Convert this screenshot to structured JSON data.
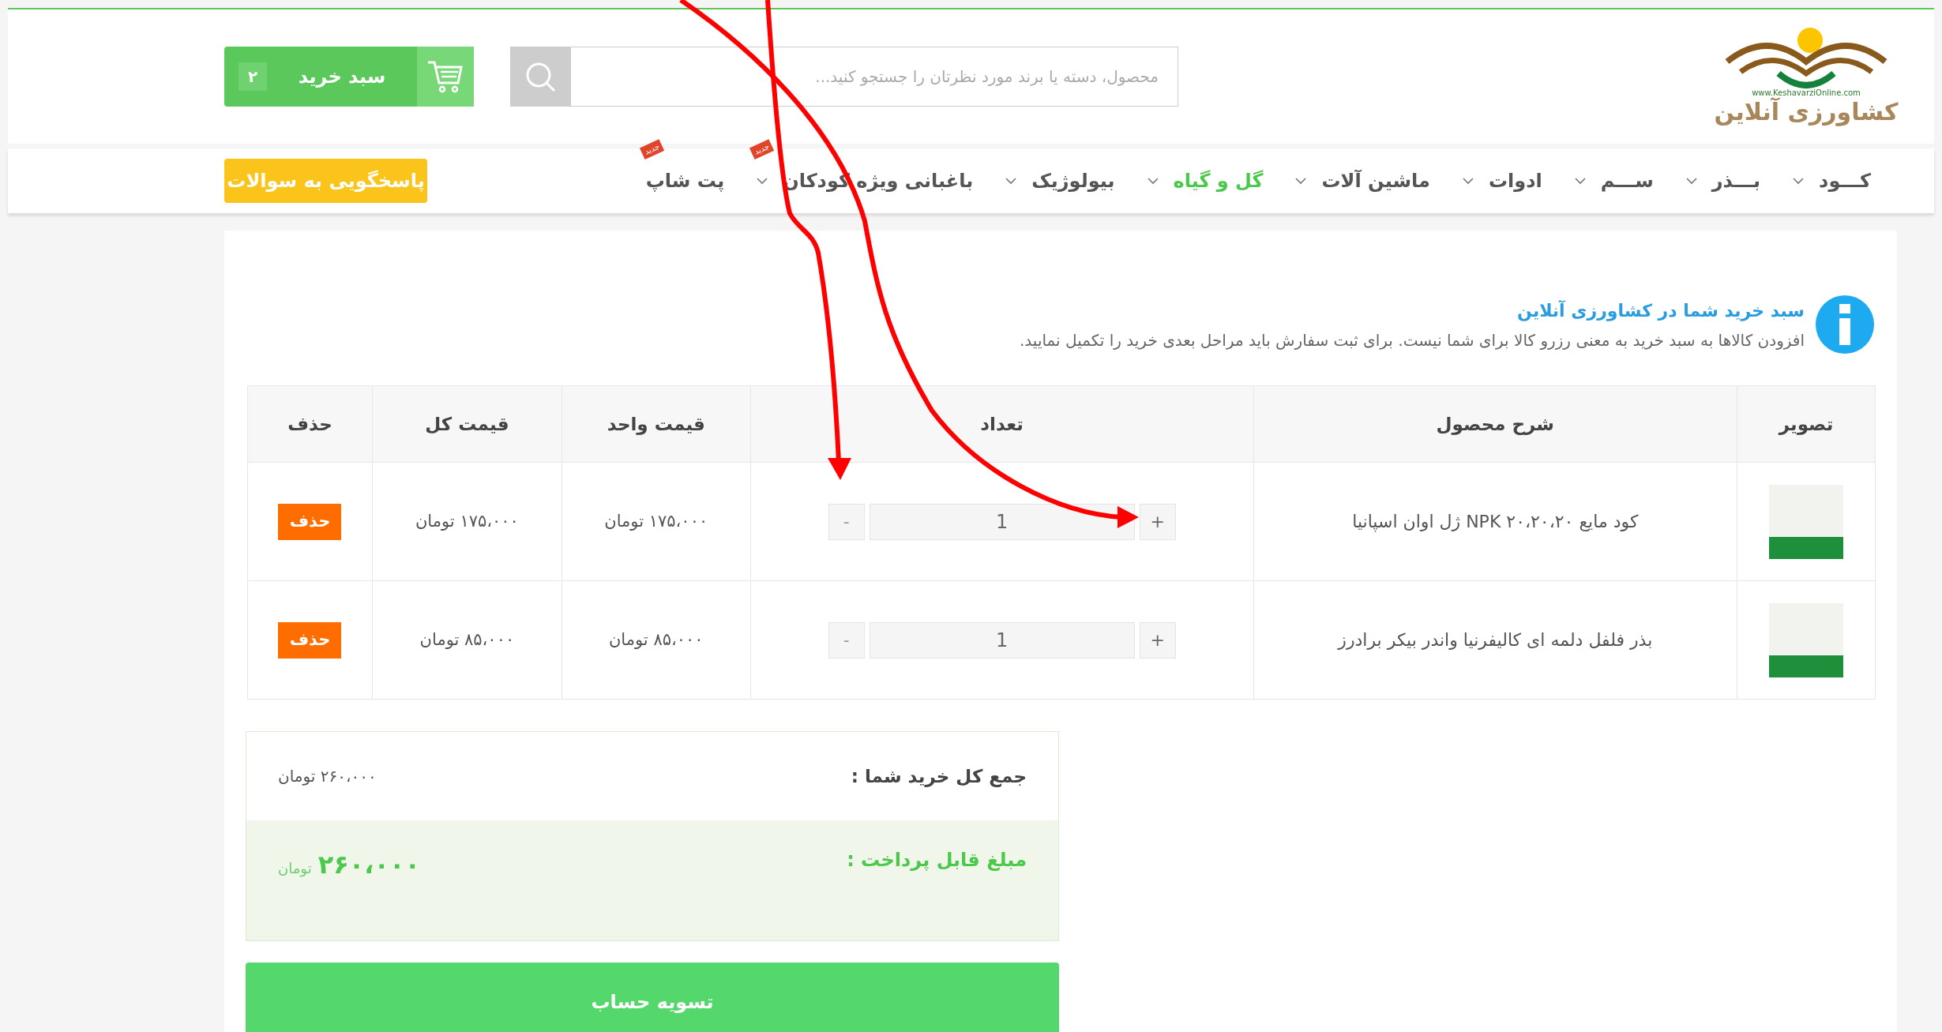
{
  "header": {
    "logo_text": "کشاورزی آنلاین",
    "logo_url": "www.KeshavarziOnline.com",
    "search": {
      "placeholder": "محصول، دسته یا برند مورد نظرتان را جستجو کنید..."
    },
    "cart": {
      "label": "سبد خرید",
      "count": "۲"
    }
  },
  "nav": {
    "items": [
      {
        "label": "کـــود",
        "selected": false,
        "dropdown": true
      },
      {
        "label": "بـــذر",
        "selected": false,
        "dropdown": true
      },
      {
        "label": "ســـم",
        "selected": false,
        "dropdown": true
      },
      {
        "label": "ادوات",
        "selected": false,
        "dropdown": true
      },
      {
        "label": "ماشین آلات",
        "selected": false,
        "dropdown": true
      },
      {
        "label": "گل و گیاه",
        "selected": true,
        "dropdown": true
      },
      {
        "label": "بیولوژیک",
        "selected": false,
        "dropdown": true
      },
      {
        "label": "باغبانی ویژه کودکان",
        "selected": false,
        "dropdown": true,
        "badge": "جدید"
      },
      {
        "label": "پت شاپ",
        "selected": false,
        "dropdown": false,
        "badge": "جدید"
      }
    ],
    "support_button": "پاسخگویی به سوالات"
  },
  "notice": {
    "title": "سبد خرید شما در کشاورزی آنلاین",
    "text": "افزودن کالاها به سبد خرید به معنی رزرو کالا برای شما نیست. برای ثبت سفارش باید مراحل بعدی خرید را تکمیل نمایید."
  },
  "table": {
    "columns": [
      "تصویر",
      "شرح محصول",
      "تعداد",
      "قیمت واحد",
      "قیمت کل",
      "حذف"
    ],
    "rows": [
      {
        "description": "کود مایع ۲۰،۲۰،۲۰ NPK ژل اوان اسپانیا",
        "quantity": "1",
        "unit_price": "۱۷۵،۰۰۰ تومان",
        "total_price": "۱۷۵،۰۰۰ تومان",
        "delete": "حذف",
        "minus": "-",
        "plus": "+"
      },
      {
        "description": "بذر فلفل دلمه ای کالیفرنیا واندر بیکر برادرز",
        "quantity": "1",
        "unit_price": "۸۵،۰۰۰ تومان",
        "total_price": "۸۵،۰۰۰ تومان",
        "delete": "حذف",
        "minus": "-",
        "plus": "+"
      }
    ]
  },
  "totals": {
    "subtotal_label": "جمع کل خرید شما :",
    "subtotal_value": "۲۶۰،۰۰۰ تومان",
    "payable_label": "مبلغ قابل پرداخت :",
    "payable_amount": "۲۶۰،۰۰۰",
    "payable_currency": "تومان"
  },
  "checkout_button": "تسویه حساب"
}
